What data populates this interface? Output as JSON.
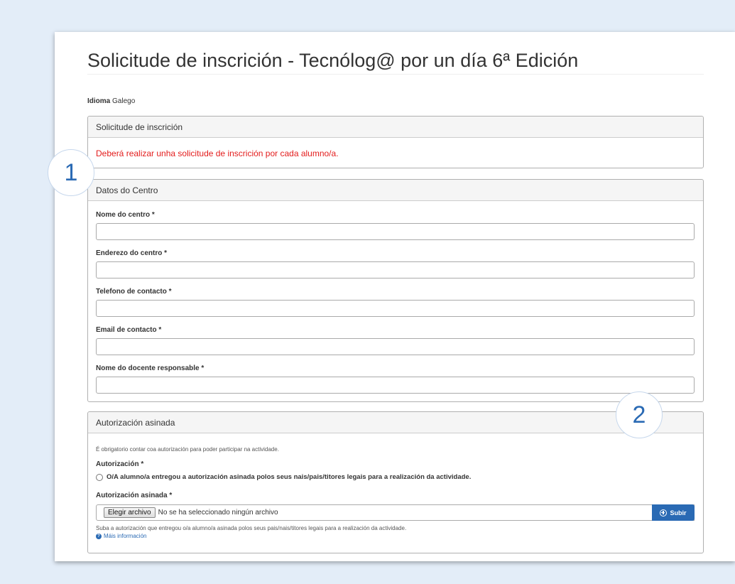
{
  "page_title": "Solicitude de inscrición - Tecnólog@ por un día 6ª Edición",
  "language": {
    "label": "Idioma",
    "value": "Galego"
  },
  "panel_request": {
    "heading": "Solicitude de inscrición",
    "warning": "Deberá realizar unha solicitude de inscrición por cada alumno/a."
  },
  "panel_center": {
    "heading": "Datos do Centro",
    "fields": [
      {
        "label": "Nome do centro *",
        "value": ""
      },
      {
        "label": "Enderezo do centro *",
        "value": ""
      },
      {
        "label": "Telefono de contacto *",
        "value": ""
      },
      {
        "label": "Email de contacto *",
        "value": ""
      },
      {
        "label": "Nome do docente responsable *",
        "value": ""
      }
    ]
  },
  "panel_auth": {
    "heading": "Autorización asinada",
    "intro": "É obrigatorio contar coa autorización para poder participar na actividade.",
    "radio_label": "Autorización *",
    "radio_option": "O/A alumno/a entregou a autorización asinada polos seus nais/pais/titores legais para a realización da actividade.",
    "file_label": "Autorización asinada *",
    "file_button": "Elegir archivo",
    "file_status": "No se ha seleccionado ningún archivo",
    "upload_button": "Subir",
    "help": "Suba a autorización que entregou o/a alumno/a asinada polos seus pais/nais/titores legais para a realización da actividade.",
    "more_info": "Máis información"
  },
  "callouts": [
    "1",
    "2"
  ]
}
